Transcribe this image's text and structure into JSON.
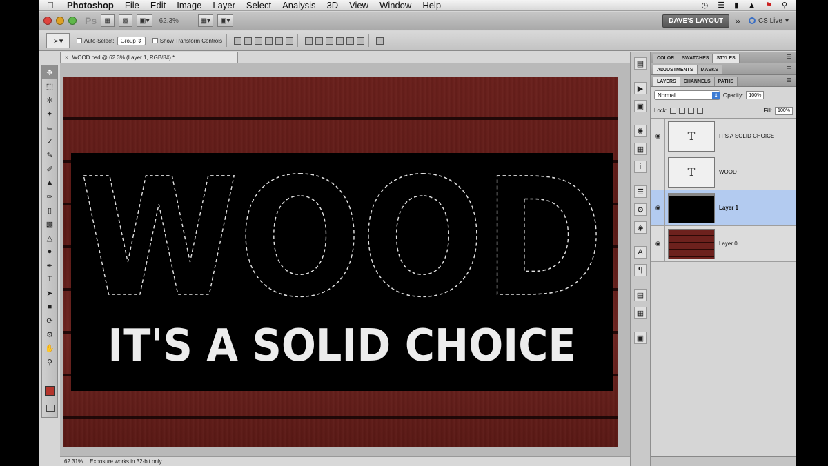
{
  "menubar": {
    "app_name": "Photoshop",
    "items": [
      "File",
      "Edit",
      "Image",
      "Layer",
      "Select",
      "Analysis",
      "3D",
      "View",
      "Window",
      "Help"
    ]
  },
  "appbar": {
    "logo": "Ps",
    "zoom": "62.3%",
    "workspace": "DAVE'S LAYOUT",
    "more": "»",
    "cs_live": "CS Live"
  },
  "options": {
    "auto_select_label": "Auto-Select:",
    "auto_select_value": "Group",
    "transform_label": "Show Transform Controls"
  },
  "document": {
    "tab_title": "WOOD.psd @ 62.3% (Layer 1, RGB/8#) *",
    "close": "×",
    "headline": "WOOD",
    "tagline": "IT'S A SOLID CHOICE",
    "status_zoom": "62.31%",
    "status_message": "Exposure works in 32-bit only"
  },
  "colors": {
    "foreground": "#b4352c",
    "background": "#ffffff",
    "wood": "#6a1f1b"
  },
  "panels": {
    "row1": [
      "COLOR",
      "SWATCHES",
      "STYLES"
    ],
    "row2": [
      "ADJUSTMENTS",
      "MASKS"
    ],
    "row3": [
      "LAYERS",
      "CHANNELS",
      "PATHS"
    ],
    "blend_mode": "Normal",
    "opacity_label": "Opacity:",
    "opacity_value": "100%",
    "lock_label": "Lock:",
    "fill_label": "Fill:",
    "fill_value": "100%"
  },
  "layers": [
    {
      "name": "IT'S A SOLID CHOICE",
      "thumb": "T",
      "visible": true,
      "selected": false
    },
    {
      "name": "WOOD",
      "thumb": "T",
      "visible": false,
      "selected": false
    },
    {
      "name": "Layer 1",
      "thumb": "",
      "visible": true,
      "selected": true
    },
    {
      "name": "Layer 0",
      "thumb": "",
      "visible": true,
      "selected": false
    }
  ]
}
